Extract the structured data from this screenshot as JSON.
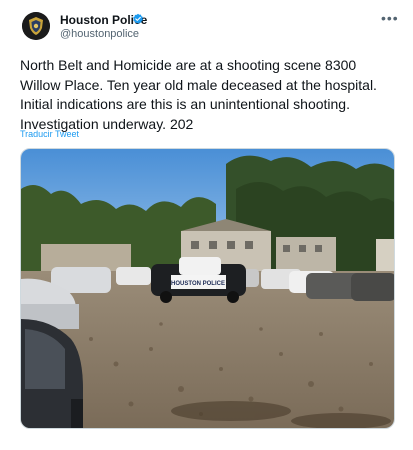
{
  "tweet": {
    "author_name": "Houston Police",
    "author_handle": "@houstonpolice",
    "text": "North Belt and Homicide are at a shooting scene 8300 Willow Place. Ten year old male deceased at the hospital. Initial indications are this is an unintentional shooting. Investigation underway. 202",
    "translate_label": "Traducir Tweet",
    "photo_text": "HOUSTON POLICE"
  },
  "icons": {
    "avatar": "police-badge-icon",
    "verified": "verified-badge-icon",
    "more": "more-options-icon"
  },
  "colors": {
    "accent": "#1d9bf0",
    "text": "#0f1419",
    "secondary_text": "#536471"
  }
}
